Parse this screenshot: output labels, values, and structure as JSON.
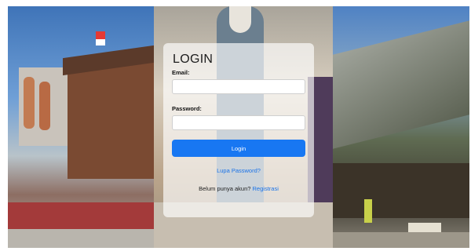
{
  "login": {
    "title": "LOGIN",
    "email_label": "Email:",
    "email_value": "",
    "password_label": "Password:",
    "password_value": "",
    "login_button": "Login",
    "forgot_link": "Lupa Password?",
    "register_prompt": "Belum punya akun?",
    "register_link": "Registrasi"
  },
  "colors": {
    "primary_button": "#1877f2",
    "link": "#1a73e8"
  }
}
